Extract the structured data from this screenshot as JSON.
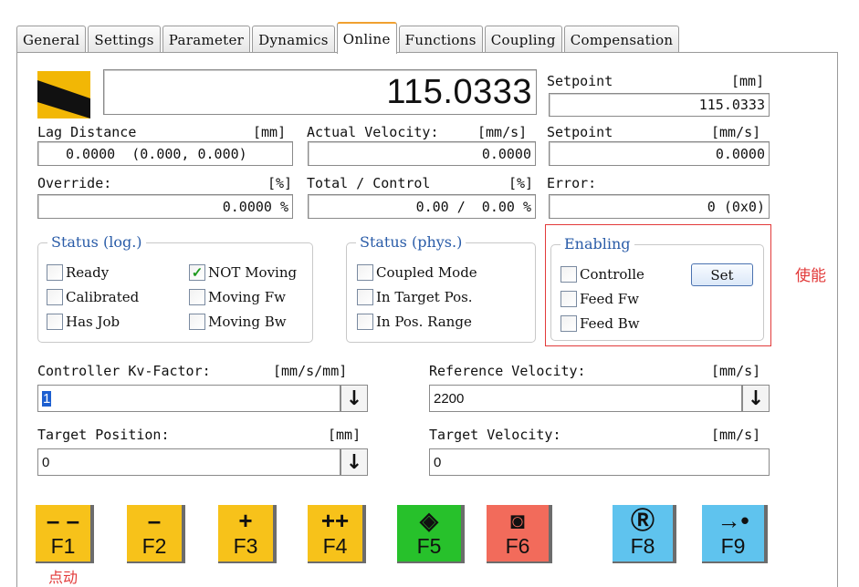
{
  "tabs": [
    "General",
    "Settings",
    "Parameter",
    "Dynamics",
    "Online",
    "Functions",
    "Coupling",
    "Compensation"
  ],
  "active_tab": "Online",
  "position": {
    "value": "115.0333"
  },
  "setpoint_pos": {
    "label": "Setpoint",
    "unit": "[mm]",
    "value": "115.0333"
  },
  "lag": {
    "label": "Lag Distance",
    "unit": "[mm]",
    "value": "0.0000  (0.000, 0.000)"
  },
  "actual_velocity": {
    "label": "Actual Velocity:",
    "unit": "[mm/s]",
    "value": "0.0000"
  },
  "setpoint_vel": {
    "label": "Setpoint",
    "unit": "[mm/s]",
    "value": "0.0000"
  },
  "override": {
    "label": "Override:",
    "unit": "[%]",
    "value": "0.0000 %"
  },
  "total_control": {
    "label": "Total / Control",
    "unit": "[%]",
    "value": "0.00 /  0.00 %"
  },
  "error": {
    "label": "Error:",
    "value": "0 (0x0)"
  },
  "status_log": {
    "title": "Status (log.)",
    "items": [
      {
        "label": "Ready",
        "checked": false
      },
      {
        "label": "NOT Moving",
        "checked": true
      },
      {
        "label": "Calibrated",
        "checked": false
      },
      {
        "label": "Moving Fw",
        "checked": false
      },
      {
        "label": "Has Job",
        "checked": false
      },
      {
        "label": "Moving Bw",
        "checked": false
      }
    ]
  },
  "status_phys": {
    "title": "Status (phys.)",
    "items": [
      {
        "label": "Coupled Mode",
        "checked": false
      },
      {
        "label": "In Target Pos.",
        "checked": false
      },
      {
        "label": "In Pos. Range",
        "checked": false
      }
    ]
  },
  "enabling": {
    "title": "Enabling",
    "items": [
      {
        "label": "Controlle",
        "checked": false
      },
      {
        "label": "Feed Fw",
        "checked": false
      },
      {
        "label": "Feed Bw",
        "checked": false
      }
    ],
    "set_label": "Set",
    "annotation": "使能"
  },
  "kv_factor": {
    "label": "Controller Kv-Factor:",
    "unit": "[mm/s/mm]",
    "value": "1"
  },
  "ref_velocity": {
    "label": "Reference Velocity:",
    "unit": "[mm/s]",
    "value": "2200"
  },
  "target_position": {
    "label": "Target Position:",
    "unit": "[mm]",
    "value": "0"
  },
  "target_velocity": {
    "label": "Target Velocity:",
    "unit": "[mm/s]",
    "value": "0"
  },
  "fkeys": [
    {
      "sym": "– –",
      "name": "F1",
      "color": "#f7c21a",
      "icon": "double-minus-icon"
    },
    {
      "sym": "–",
      "name": "F2",
      "color": "#f7c21a",
      "icon": "minus-icon"
    },
    {
      "sym": "+",
      "name": "F3",
      "color": "#f7c21a",
      "icon": "plus-icon"
    },
    {
      "sym": "++",
      "name": "F4",
      "color": "#f7c21a",
      "icon": "double-plus-icon"
    },
    {
      "sym": "◈",
      "name": "F5",
      "color": "#27c12b",
      "icon": "start-icon"
    },
    {
      "sym": "◙",
      "name": "F6",
      "color": "#f26b5b",
      "icon": "stop-icon"
    },
    {
      "sym": "Ⓡ",
      "name": "F8",
      "color": "#5fc3ee",
      "icon": "reset-icon"
    },
    {
      "sym": "→•",
      "name": "F9",
      "color": "#5fc3ee",
      "icon": "goto-position-icon"
    }
  ],
  "jog_annotation": "点动"
}
